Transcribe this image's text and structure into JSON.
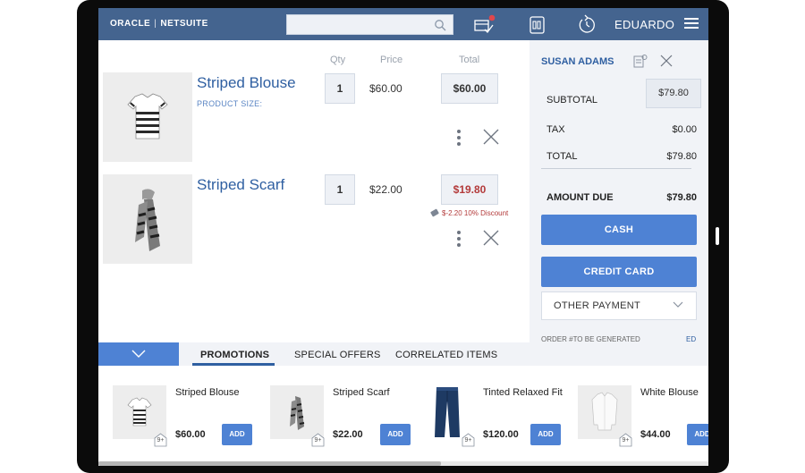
{
  "header": {
    "logo_brand": "ORACLE",
    "logo_product": "NETSUITE",
    "search_placeholder": "",
    "user_name": "EDUARDO"
  },
  "cart": {
    "columns": {
      "qty": "Qty",
      "price": "Price",
      "total": "Total"
    },
    "items": [
      {
        "name": "Striped Blouse",
        "subtitle": "PRODUCT SIZE:",
        "qty": "1",
        "price": "$60.00",
        "total": "$60.00",
        "discount": "",
        "image": "blouse-image"
      },
      {
        "name": "Striped Scarf",
        "subtitle": "",
        "qty": "1",
        "price": "$22.00",
        "total": "$19.80",
        "discount": "$-2.20 10% Discount",
        "image": "scarf-image"
      }
    ]
  },
  "summary": {
    "customer_name": "SUSAN ADAMS",
    "subtotal_label": "SUBTOTAL",
    "subtotal_value": "$79.80",
    "tax_label": "TAX",
    "tax_value": "$0.00",
    "total_label": "TOTAL",
    "total_value": "$79.80",
    "amount_due_label": "AMOUNT DUE",
    "amount_due_value": "$79.80",
    "cash_label": "CASH",
    "credit_label": "CREDIT CARD",
    "other_payment_label": "OTHER PAYMENT",
    "order_number_text": "ORDER #TO BE GENERATED",
    "order_number_right": "ED"
  },
  "tabs": [
    {
      "label": "PROMOTIONS",
      "active": true
    },
    {
      "label": "SPECIAL OFFERS",
      "active": false
    },
    {
      "label": "CORRELATED ITEMS",
      "active": false
    }
  ],
  "products": [
    {
      "name": "Striped Blouse",
      "price": "$60.00",
      "add_label": "ADD",
      "badge": "9+"
    },
    {
      "name": "Striped Scarf",
      "price": "$22.00",
      "add_label": "ADD",
      "badge": "9+"
    },
    {
      "name": "Tinted Relaxed Fit",
      "price": "$120.00",
      "add_label": "ADD",
      "badge": "9+"
    },
    {
      "name": "White Blouse",
      "price": "$44.00",
      "add_label": "ADD",
      "badge": "9+"
    }
  ],
  "colors": {
    "header_bg": "#44648f",
    "accent_blue": "#4e82d4",
    "link_blue": "#2f5fa1",
    "discount_red": "#b33a3a"
  }
}
